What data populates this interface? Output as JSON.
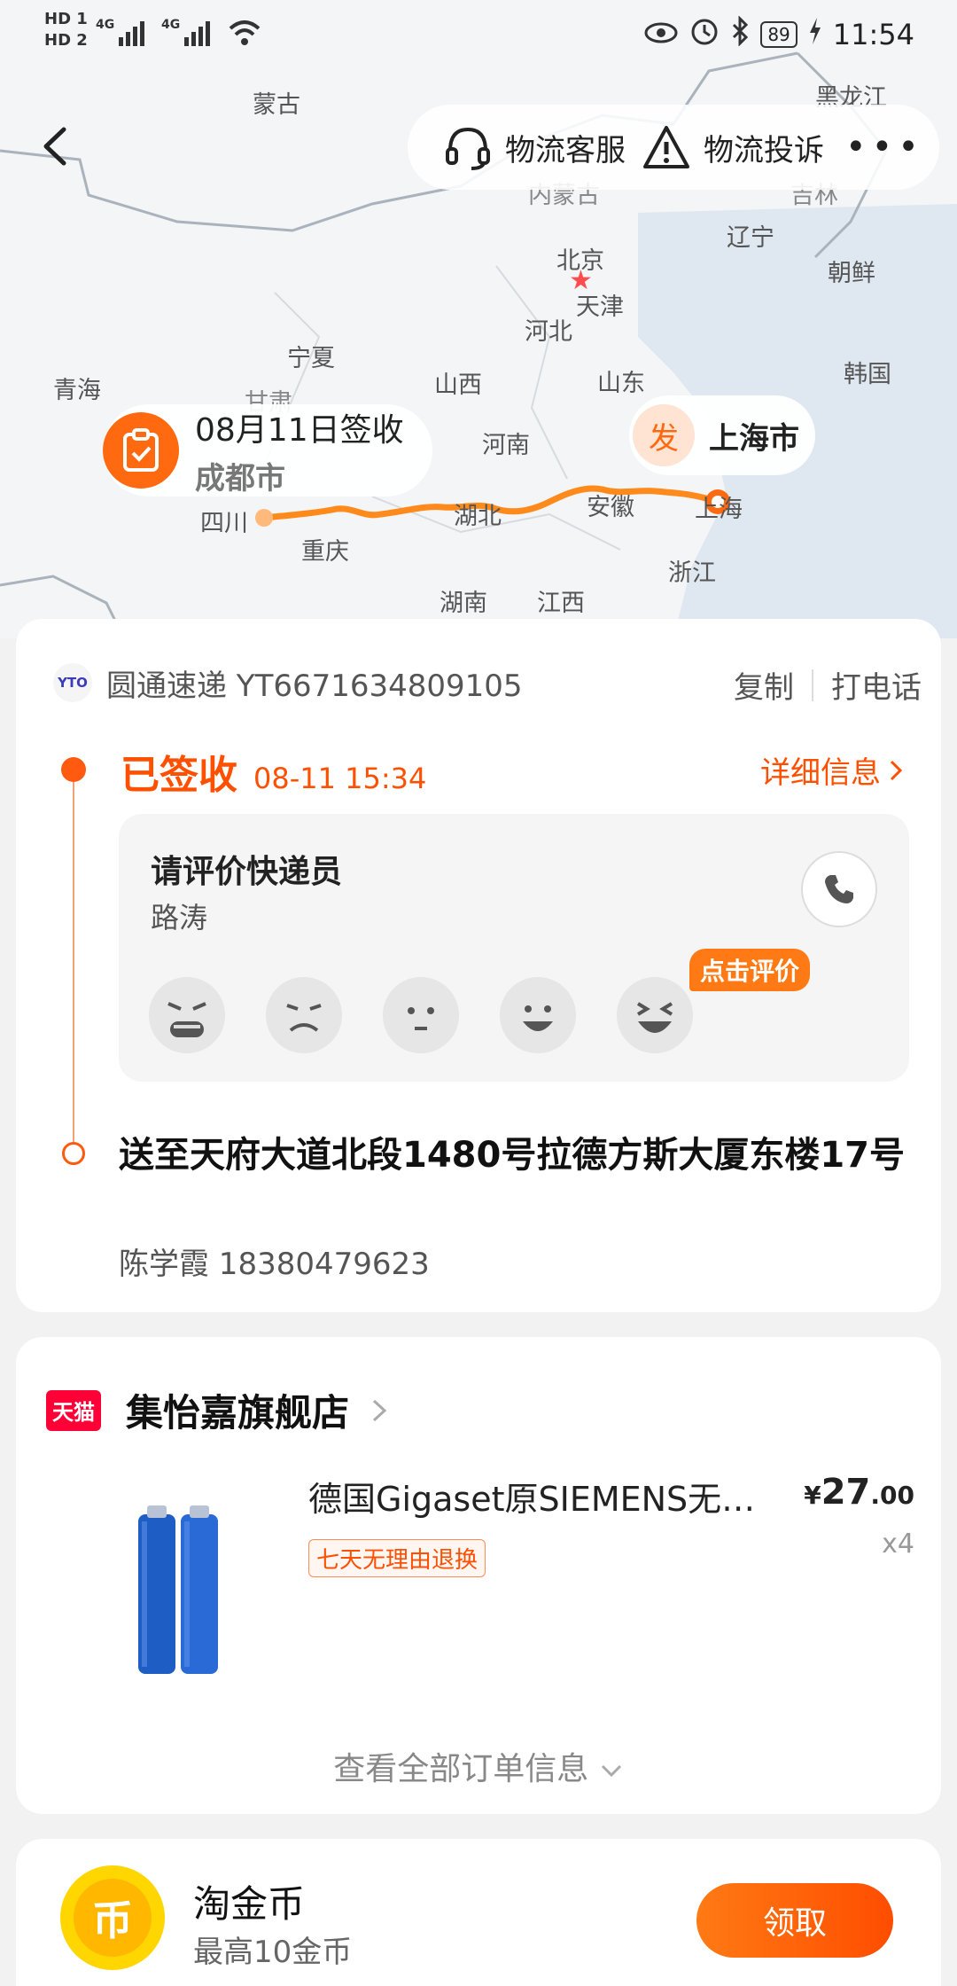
{
  "status_bar": {
    "sim1": "HD 1",
    "sim2": "HD 2",
    "net1": "4G",
    "net2": "4G",
    "battery": "89",
    "time": "11:54"
  },
  "top_nav": {
    "service_label": "物流客服",
    "complaint_label": "物流投诉",
    "more_label": "•••"
  },
  "map": {
    "regions": [
      "蒙古",
      "黑龙江",
      "内蒙古",
      "吉林",
      "辽宁",
      "北京",
      "天津",
      "朝鲜",
      "河北",
      "宁夏",
      "青海",
      "甘肃",
      "山西",
      "山东",
      "韩国",
      "河南",
      "四川",
      "湖北",
      "安徽",
      "上海",
      "重庆",
      "浙江",
      "湖南",
      "江西"
    ],
    "sign_date": "08月11日签收",
    "sign_city": "成都市",
    "ship_icon": "发",
    "ship_city": "上海市"
  },
  "tracking": {
    "carrier_logo": "YTO",
    "carrier_line": "圆通速递 YT6671634809105",
    "copy_label": "复制",
    "call_label": "打电话",
    "status": "已签收",
    "status_time": "08-11 15:34",
    "detail_label": "详细信息",
    "rate_title": "请评价快递员",
    "courier_name": "路涛",
    "rate_tag": "点击评价",
    "address": "送至天府大道北段1480号拉德方斯大厦东楼17号",
    "contact": "陈学霞 18380479623"
  },
  "shop": {
    "logo": "天猫",
    "name": "集怡嘉旗舰店",
    "product_title": "德国Gigaset原SIEMENS无…",
    "return_tag": "七天无理由退换",
    "price_symbol": "¥",
    "price_int": "27",
    "price_dec": ".00",
    "qty": "x4",
    "view_all": "查看全部订单信息"
  },
  "coins": {
    "icon_char": "币",
    "title": "淘金币",
    "subtitle": "最高10金币",
    "button": "领取"
  },
  "colors": {
    "accent": "#ff5000",
    "route": "#ff8a1c"
  }
}
